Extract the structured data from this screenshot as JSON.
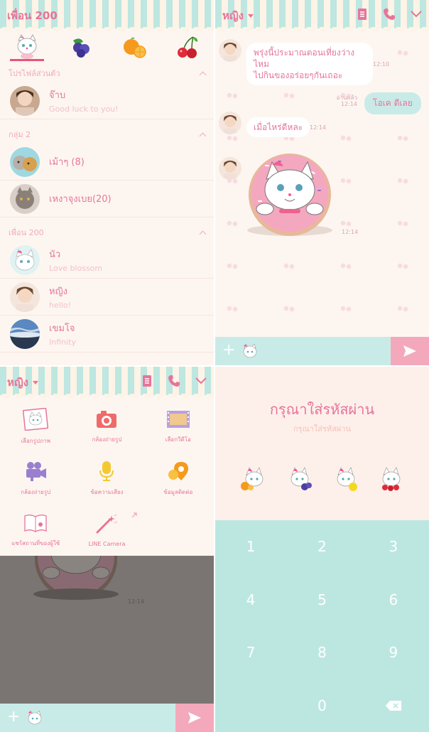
{
  "friends_screen": {
    "header_title": "เพื่อน 200",
    "tabs": [
      "cat-icon",
      "blueberry-icon",
      "orange-icon",
      "cherry-icon"
    ],
    "sections": [
      {
        "label": "โปรไฟล์ส่วนตัว"
      },
      {
        "label": "กลุ่ม 2"
      },
      {
        "label": "เพื่อน 200"
      }
    ],
    "profile": {
      "name": "จ๊าบ",
      "status": "Good luck to you!"
    },
    "groups": [
      {
        "name": "เม้าๆ (8)"
      },
      {
        "name": "เหงาจุงเบย(20)"
      }
    ],
    "friends": [
      {
        "name": "นัว",
        "status": "Love blossom"
      },
      {
        "name": "หญิง",
        "status": "hello!"
      },
      {
        "name": "เขมโจ",
        "status": "Infinity"
      }
    ]
  },
  "chat_screen": {
    "header_title": "หญิง",
    "messages": [
      {
        "text_line1": "พรุ่งนี้ประมาณตอนเที่ยงว่างไหม",
        "text_line2": "ไปกินของอร่อยๆกันเถอะ",
        "time": "12:10"
      },
      {
        "read": "อ่านแล้ว",
        "time": "12:14",
        "text": "โอเค ดีเลย"
      },
      {
        "text": "เมื่อไหร่ดีหละ",
        "time": "12:14"
      },
      {
        "time": "12:14"
      }
    ]
  },
  "attach_screen": {
    "header_title": "หญิง",
    "items": [
      {
        "label": "เลือกรูปภาพ"
      },
      {
        "label": "กล้องถ่ายรูป"
      },
      {
        "label": "เลือกวีดีโอ"
      },
      {
        "label": "กล้องถ่ายรูป"
      },
      {
        "label": "ข้อความเสียง"
      },
      {
        "label": "ข้อมูลติดต่อ"
      },
      {
        "label": "แชร์สถานที่ของผู้ใช้"
      },
      {
        "label": "LINE Camera"
      }
    ],
    "time": "12:14"
  },
  "passcode_screen": {
    "title": "กรุณาใส่รหัสผ่าน",
    "subtitle": "กรุณาใส่รหัสผ่าน",
    "keys": [
      "1",
      "2",
      "3",
      "4",
      "5",
      "6",
      "7",
      "8",
      "9",
      "",
      "0",
      "delete-icon"
    ]
  },
  "colors": {
    "accent_pink": "#e7749a",
    "mint": "#bce7e1",
    "background": "#fdf6f0"
  }
}
